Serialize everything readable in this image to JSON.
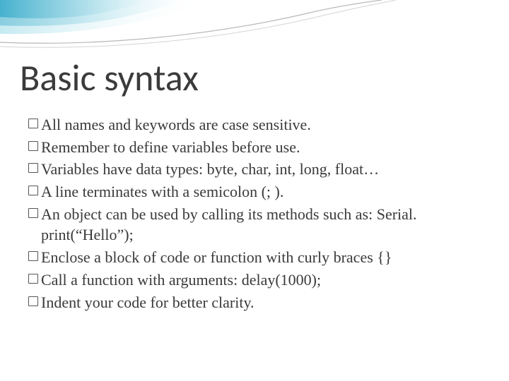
{
  "title": "Basic syntax",
  "bullets": [
    {
      "text": "All names and keywords are case sensitive."
    },
    {
      "text": "Remember to define variables before use."
    },
    {
      "text": "Variables have data types: byte, char, int, long, float…"
    },
    {
      "text": "A line terminates with a semicolon (; )."
    },
    {
      "text": "An object can be used by calling its methods such as: Serial. print(“Hello”);"
    },
    {
      "text": "Enclose a block of code or function with curly braces {}"
    },
    {
      "text": "Call a function with arguments: delay(1000);"
    },
    {
      "text": "Indent your code for better clarity."
    }
  ],
  "ribbon_colors": {
    "light": "#bfe7f0",
    "mid": "#7ec9dc",
    "deep": "#3faecb",
    "line": "#9a9a9a"
  }
}
